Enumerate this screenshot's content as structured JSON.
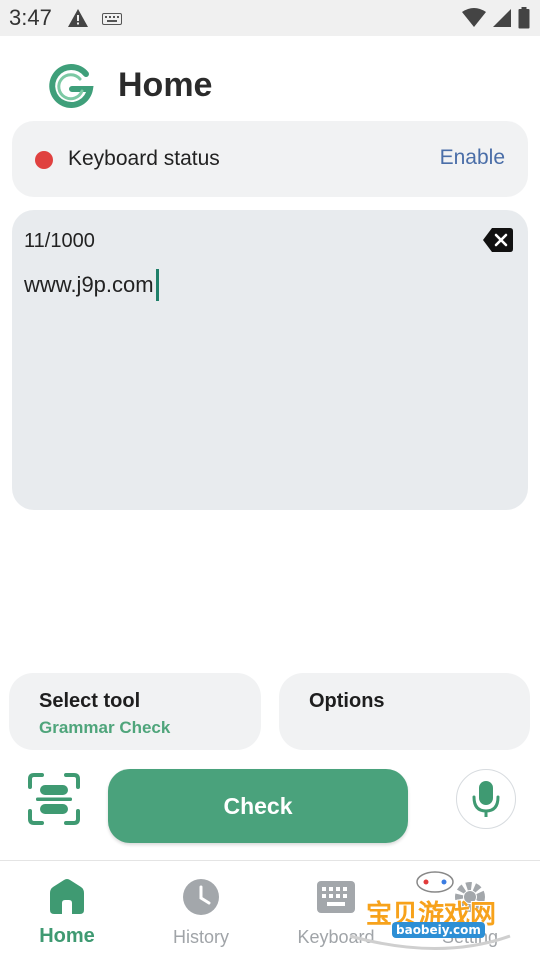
{
  "status_bar": {
    "time": "3:47",
    "icons": [
      "warning-icon",
      "keyboard-icon",
      "wifi-icon",
      "signal-icon",
      "battery-icon"
    ]
  },
  "header": {
    "title": "Home",
    "logo": "grammar-g-logo"
  },
  "keyboard_status": {
    "label": "Keyboard status",
    "action": "Enable",
    "indicator_color": "#e0413f"
  },
  "editor": {
    "char_count": "11/1000",
    "text": "www.j9p.com"
  },
  "tools": {
    "select_tool": {
      "label": "Select tool",
      "value": "Grammar Check"
    },
    "options": {
      "label": "Options"
    }
  },
  "actions": {
    "check_label": "Check"
  },
  "bottom_nav": {
    "items": [
      {
        "label": "Home",
        "icon": "home-icon",
        "active": true
      },
      {
        "label": "History",
        "icon": "clock-icon",
        "active": false
      },
      {
        "label": "Keyboard",
        "icon": "keyboard-icon",
        "active": false
      },
      {
        "label": "Setting",
        "icon": "gear-icon",
        "active": false
      }
    ]
  },
  "watermark": {
    "text": "宝贝游戏网",
    "url": "baobeiy.com"
  },
  "colors": {
    "accent": "#4aa27c",
    "link": "#4a6ea8",
    "card": "#f1f2f3",
    "editor_bg": "#e8ebee"
  }
}
